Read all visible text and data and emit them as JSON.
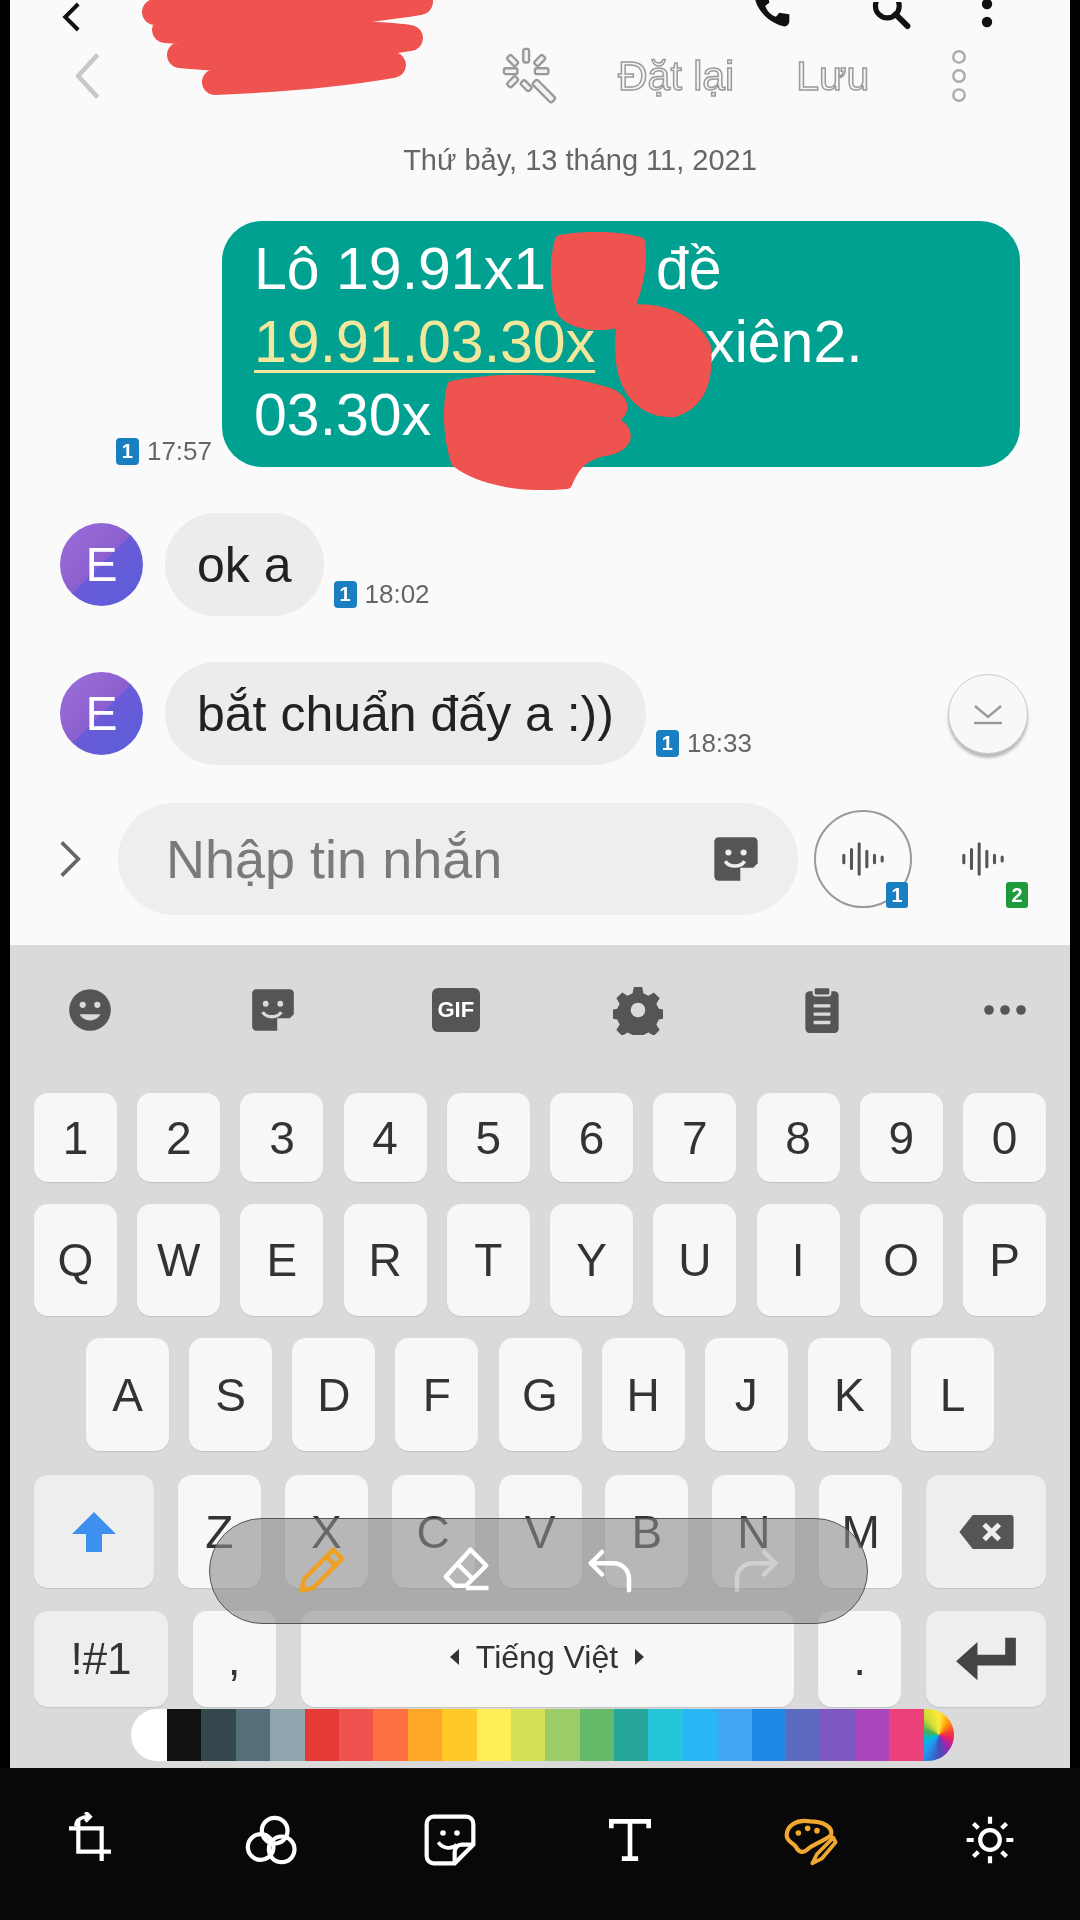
{
  "editor_bar": {
    "actions": [
      {
        "label": "Đặt lại"
      },
      {
        "label": "Lưu"
      }
    ]
  },
  "date": "Thứ bảy, 13 tháng 11, 2021",
  "messages": [
    {
      "kind": "outgoing",
      "lines": [
        [
          {
            "text": "Lô 19.91x1",
            "link": false
          },
          {
            "text": "đề",
            "link": false
          }
        ],
        [
          {
            "text": "19.91.03.30x",
            "link": true
          },
          {
            "text": "xiên2.",
            "link": false
          }
        ],
        [
          {
            "text": "03.30x",
            "link": false
          }
        ]
      ],
      "time": "17:57",
      "sim": "1"
    },
    {
      "kind": "incoming",
      "avatar": "E",
      "text": "ok a",
      "time": "18:02",
      "sim": "1"
    },
    {
      "kind": "incoming",
      "avatar": "E",
      "text": "bắt chuẩn đấy a :))",
      "time": "18:33",
      "sim": "1"
    }
  ],
  "composer": {
    "placeholder": "Nhập tin nhắn",
    "voice_buttons": [
      {
        "sim": "1",
        "selected": true,
        "color": "#1a7fc1"
      },
      {
        "sim": "2",
        "selected": false,
        "color": "#1e9a3c"
      }
    ]
  },
  "keyboard": {
    "gif_label": "GIF",
    "rows": [
      {
        "keys": [
          {
            "kind": "char",
            "label": "1"
          },
          {
            "kind": "char",
            "label": "2"
          },
          {
            "kind": "char",
            "label": "3"
          },
          {
            "kind": "char",
            "label": "4"
          },
          {
            "kind": "char",
            "label": "5"
          },
          {
            "kind": "char",
            "label": "6"
          },
          {
            "kind": "char",
            "label": "7"
          },
          {
            "kind": "char",
            "label": "8"
          },
          {
            "kind": "char",
            "label": "9"
          },
          {
            "kind": "char",
            "label": "0"
          }
        ]
      },
      {
        "keys": [
          {
            "kind": "char",
            "label": "Q"
          },
          {
            "kind": "char",
            "label": "W"
          },
          {
            "kind": "char",
            "label": "E"
          },
          {
            "kind": "char",
            "label": "R"
          },
          {
            "kind": "char",
            "label": "T"
          },
          {
            "kind": "char",
            "label": "Y"
          },
          {
            "kind": "char",
            "label": "U"
          },
          {
            "kind": "char",
            "label": "I"
          },
          {
            "kind": "char",
            "label": "O"
          },
          {
            "kind": "char",
            "label": "P"
          }
        ]
      },
      {
        "keys": [
          {
            "kind": "char",
            "label": "A"
          },
          {
            "kind": "char",
            "label": "S"
          },
          {
            "kind": "char",
            "label": "D"
          },
          {
            "kind": "char",
            "label": "F"
          },
          {
            "kind": "char",
            "label": "G"
          },
          {
            "kind": "char",
            "label": "H"
          },
          {
            "kind": "char",
            "label": "J"
          },
          {
            "kind": "char",
            "label": "K"
          },
          {
            "kind": "char",
            "label": "L"
          }
        ]
      },
      {
        "keys": [
          {
            "kind": "shift",
            "on": true
          },
          {
            "kind": "char",
            "label": "Z"
          },
          {
            "kind": "char",
            "label": "X"
          },
          {
            "kind": "char",
            "label": "C"
          },
          {
            "kind": "char",
            "label": "V"
          },
          {
            "kind": "char",
            "label": "B"
          },
          {
            "kind": "char",
            "label": "N"
          },
          {
            "kind": "char",
            "label": "M"
          },
          {
            "kind": "backspace"
          }
        ]
      },
      {
        "keys": [
          {
            "kind": "symbols",
            "label": "!#1"
          },
          {
            "kind": "char",
            "label": ","
          },
          {
            "kind": "space",
            "label": "Tiếng Việt"
          },
          {
            "kind": "char",
            "label": "."
          },
          {
            "kind": "enter"
          }
        ]
      }
    ]
  },
  "pen_tools": [
    {
      "kind": "pen",
      "selected": true,
      "disabled": false
    },
    {
      "kind": "eraser",
      "selected": false,
      "disabled": false
    },
    {
      "kind": "undo",
      "selected": false,
      "disabled": false
    },
    {
      "kind": "redo",
      "selected": false,
      "disabled": true
    }
  ],
  "palette": [
    {
      "kind": "swatch",
      "color": "#ffffff"
    },
    {
      "kind": "swatch",
      "color": "#111111"
    },
    {
      "kind": "swatch",
      "color": "#37474f"
    },
    {
      "kind": "swatch",
      "color": "#546e7a"
    },
    {
      "kind": "swatch",
      "color": "#90a4ae"
    },
    {
      "kind": "swatch",
      "color": "#e53935"
    },
    {
      "kind": "swatch",
      "color": "#ef5350"
    },
    {
      "kind": "swatch",
      "color": "#ff7043"
    },
    {
      "kind": "swatch",
      "color": "#ffa726"
    },
    {
      "kind": "swatch",
      "color": "#ffca28"
    },
    {
      "kind": "swatch",
      "color": "#ffee58"
    },
    {
      "kind": "swatch",
      "color": "#d4e157"
    },
    {
      "kind": "swatch",
      "color": "#9ccc65"
    },
    {
      "kind": "swatch",
      "color": "#66bb6a"
    },
    {
      "kind": "swatch",
      "color": "#26a69a"
    },
    {
      "kind": "swatch",
      "color": "#26c6da"
    },
    {
      "kind": "swatch",
      "color": "#29b6f6"
    },
    {
      "kind": "swatch",
      "color": "#42a5f5"
    },
    {
      "kind": "swatch",
      "color": "#1e88e5"
    },
    {
      "kind": "swatch",
      "color": "#5c6bc0"
    },
    {
      "kind": "swatch",
      "color": "#7e57c2"
    },
    {
      "kind": "swatch",
      "color": "#ab47bc"
    },
    {
      "kind": "swatch",
      "color": "#ec407a"
    },
    {
      "kind": "rainbow"
    }
  ],
  "bottom_tools": [
    {
      "kind": "crop",
      "selected": false
    },
    {
      "kind": "filters",
      "selected": false
    },
    {
      "kind": "sticker",
      "selected": false
    },
    {
      "kind": "text",
      "selected": false
    },
    {
      "kind": "draw",
      "selected": true
    },
    {
      "kind": "adjust",
      "selected": false
    }
  ]
}
